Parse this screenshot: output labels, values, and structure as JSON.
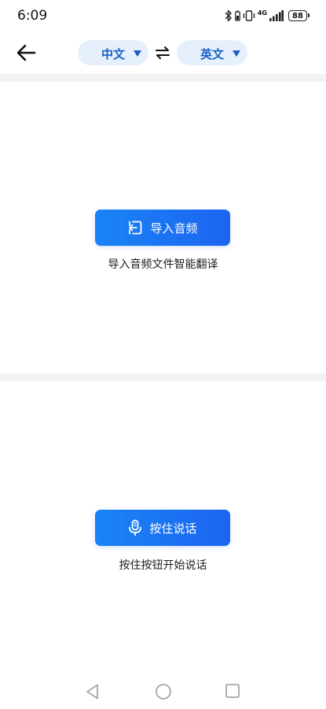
{
  "status_bar": {
    "time": "6:09",
    "network": "4G",
    "battery": "88",
    "icons": [
      "bluetooth-icon",
      "vibrate-icon",
      "signal-icon",
      "battery-icon"
    ]
  },
  "header": {
    "back_icon": "arrow-left-icon",
    "source_language": "中文",
    "target_language": "英文",
    "swap_icon": "swap-arrows-icon"
  },
  "import_section": {
    "button_label": "导入音频",
    "button_icon": "import-icon",
    "caption": "导入音频文件智能翻译"
  },
  "speak_section": {
    "button_label": "按住说话",
    "button_icon": "microphone-icon",
    "caption": "按住按钮开始说话"
  },
  "nav_bar": {
    "icons": [
      "nav-back-triangle-icon",
      "nav-home-circle-icon",
      "nav-recents-square-icon"
    ]
  },
  "colors": {
    "accent": "#1c64f0",
    "accent_light": "#1a84f5",
    "pill_background": "#e6f0fd",
    "pill_text": "#1a5fc4",
    "divider": "#f2f2f2"
  }
}
